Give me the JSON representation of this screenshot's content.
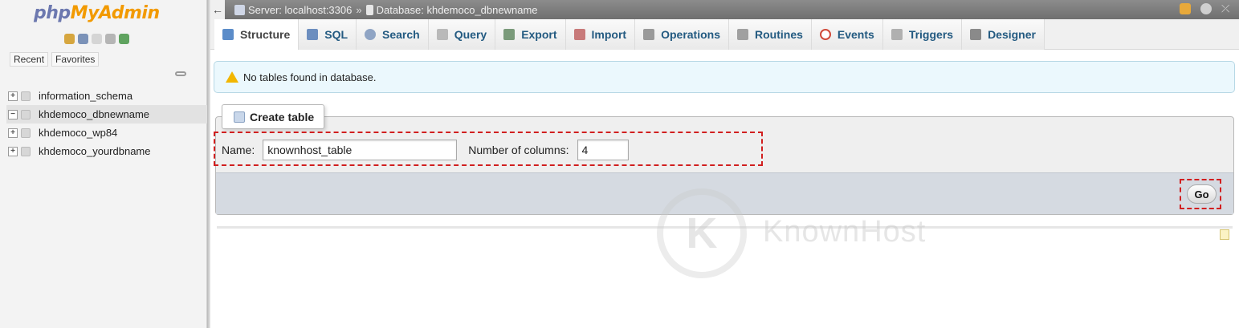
{
  "logo": {
    "part1": "php",
    "part2": "MyAdmin"
  },
  "left_nav": {
    "recent": "Recent",
    "favorites": "Favorites"
  },
  "databases": [
    {
      "name": "information_schema"
    },
    {
      "name": "khdemoco_dbnewname"
    },
    {
      "name": "khdemoco_wp84"
    },
    {
      "name": "khdemoco_yourdbname"
    }
  ],
  "breadcrumb": {
    "server": "Server: localhost:3306",
    "separator": "»",
    "database": "Database: khdemoco_dbnewname"
  },
  "tabs": [
    {
      "label": "Structure",
      "icon": "structure-icon",
      "color": "#5b8cc9"
    },
    {
      "label": "SQL",
      "icon": "sql-icon",
      "color": "#6c8ebf"
    },
    {
      "label": "Search",
      "icon": "search-icon",
      "color": "#8fa4c4"
    },
    {
      "label": "Query",
      "icon": "query-icon",
      "color": "#b9b9b9"
    },
    {
      "label": "Export",
      "icon": "export-icon",
      "color": "#7a9a7a"
    },
    {
      "label": "Import",
      "icon": "import-icon",
      "color": "#c87a7a"
    },
    {
      "label": "Operations",
      "icon": "wrench-icon",
      "color": "#9a9a9a"
    },
    {
      "label": "Routines",
      "icon": "routines-icon",
      "color": "#a0a0a0"
    },
    {
      "label": "Events",
      "icon": "clock-icon",
      "color": "#d04a3a"
    },
    {
      "label": "Triggers",
      "icon": "triggers-icon",
      "color": "#b0b0b0"
    },
    {
      "label": "Designer",
      "icon": "designer-icon",
      "color": "#8a8a8a"
    }
  ],
  "notice": {
    "text": "No tables found in database."
  },
  "create_table": {
    "legend": "Create table",
    "name_label": "Name:",
    "name_value": "knownhost_table",
    "columns_label": "Number of columns:",
    "columns_value": "4",
    "go_label": "Go"
  },
  "watermark": {
    "letter": "K",
    "text": "KnownHost"
  },
  "colors": {
    "accent": "#235a81",
    "highlight": "#d11f1f",
    "notice_bg": "#ebf8fd"
  }
}
